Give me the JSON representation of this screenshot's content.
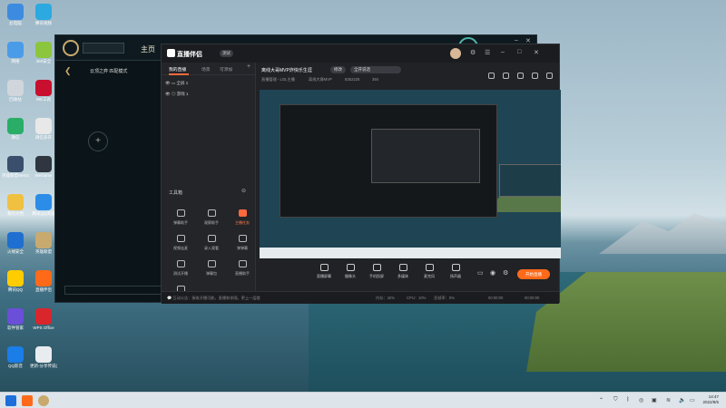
{
  "desktop": {
    "icons": [
      {
        "label": "此电脑",
        "color": "#3c8be0",
        "col": 0,
        "row": 0
      },
      {
        "label": "腾讯视频",
        "color": "#2ba9e0",
        "col": 1,
        "row": 0
      },
      {
        "label": "网络",
        "color": "#4a9ce8",
        "col": 0,
        "row": 1
      },
      {
        "label": "360安全",
        "color": "#8cc63f",
        "col": 1,
        "row": 1
      },
      {
        "label": "回收站",
        "color": "#d0d6dc",
        "col": 0,
        "row": 2
      },
      {
        "label": "WE工具",
        "color": "#c8102e",
        "col": 1,
        "row": 2
      },
      {
        "label": "微信",
        "color": "#2aae67",
        "col": 0,
        "row": 3
      },
      {
        "label": "微信多开",
        "color": "#e8e8e8",
        "col": 1,
        "row": 3
      },
      {
        "label": "英雄联盟WeGame",
        "color": "#3a4f6b",
        "col": 0,
        "row": 4
      },
      {
        "label": "WeGame",
        "color": "#2f3640",
        "col": 1,
        "row": 4
      },
      {
        "label": "我的文档",
        "color": "#f0c040",
        "col": 0,
        "row": 5
      },
      {
        "label": "腾讯QQ浏览",
        "color": "#2c8de8",
        "col": 1,
        "row": 5
      },
      {
        "label": "火绒安全",
        "color": "#1f6fd1",
        "col": 0,
        "row": 6
      },
      {
        "label": "英雄联盟",
        "color": "#c8aa6e",
        "col": 1,
        "row": 6
      },
      {
        "label": "腾讯QQ",
        "color": "#ffcc00",
        "col": 0,
        "row": 7
      },
      {
        "label": "直播伴侣",
        "color": "#ff6a1a",
        "col": 1,
        "row": 7
      },
      {
        "label": "软件管家",
        "color": "#6b4fd8",
        "col": 0,
        "row": 8
      },
      {
        "label": "WPS Office",
        "color": "#d9262c",
        "col": 1,
        "row": 8
      },
      {
        "label": "QQ影音",
        "color": "#1a7de8",
        "col": 0,
        "row": 9
      },
      {
        "label": "更新-分享传说(下载版)",
        "color": "#e9ecef",
        "col": 1,
        "row": 9
      }
    ]
  },
  "lol": {
    "home_label": "主页",
    "nav_mode": "云顶之弈    匹配模式"
  },
  "zb": {
    "app_name": "直播伴侣",
    "version_badge": "测试",
    "tabs": [
      "我的直播",
      "场景",
      "可添加"
    ],
    "add_symbol": "+",
    "scenes": [
      "全屏 1",
      "游戏 1"
    ],
    "tools_title": "工具箱",
    "tools": [
      {
        "label": "弹幕助手",
        "hl": false
      },
      {
        "label": "观察助手",
        "hl": false
      },
      {
        "label": "主播任务",
        "hl": true
      },
      {
        "label": "视频连麦",
        "hl": false
      },
      {
        "label": "录入观看",
        "hl": false
      },
      {
        "label": "弹弹幕",
        "hl": false
      },
      {
        "label": "测试开播",
        "hl": false
      },
      {
        "label": "弹幕包",
        "hl": false
      },
      {
        "label": "直播助手",
        "hl": false
      },
      {
        "label": "红包",
        "hl": false
      }
    ],
    "room_title": "离线大哥MVP炸快乐生涯",
    "title_edit": "修改",
    "category": "全开说话",
    "meta": [
      "直播管理 - LOL主播",
      "离线大哥MVP",
      "8352225",
      "394"
    ],
    "controls": [
      "直播屏幕",
      "摄像头",
      "手机投屏",
      "多媒体",
      "麦克风",
      "扬声器"
    ],
    "start_button": "开始直播",
    "status": [
      "💬 互动公告：接收开播可能，直播和伴随，更上一层楼",
      "内存：32%",
      "CPU：10%",
      "丢帧率：0%",
      "00:00:00",
      "00:00:00"
    ]
  },
  "taskbar": {
    "time": "14:47",
    "date": "2022/8/5"
  }
}
